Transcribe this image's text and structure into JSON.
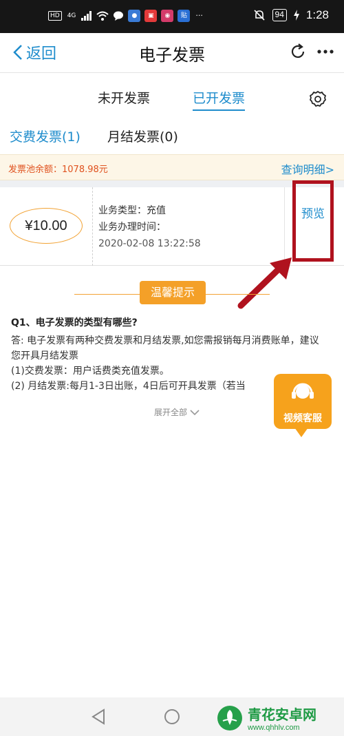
{
  "status_bar": {
    "signal_label": "HD",
    "network": "4G",
    "battery": "94",
    "time": "1:28",
    "icons": [
      "wifi-icon",
      "chat-icon",
      "app-icon",
      "notification-off-icon",
      "charging-icon"
    ]
  },
  "nav": {
    "back_label": "返回",
    "title": "电子发票"
  },
  "tabs": {
    "unissued": "未开发票",
    "issued": "已开发票"
  },
  "subtabs": {
    "payment": "交费发票(1)",
    "monthly": "月结发票(0)"
  },
  "pool": {
    "balance": "发票池余额：1078.98元",
    "link": "查询明细>"
  },
  "invoice": {
    "amount": "¥10.00",
    "type_line": "业务类型：充值",
    "time_label": "业务办理时间：",
    "time_value": "2020-02-08 13:22:58",
    "preview": "预览"
  },
  "tips": {
    "badge": "温馨提示",
    "question": "Q1、电子发票的类型有哪些?",
    "answer": "答: 电子发票有两种交费发票和月结发票,如您需报销每月消费账单，建议您开具月结发票",
    "item1": "(1)交费发票：用户话费类充值发票。",
    "item2": "(2) 月结发票:每月1-3日出账，4日后可开具发票（若当",
    "expand": "展开全部"
  },
  "video_service": {
    "label": "视频客服"
  },
  "watermark": {
    "title": "青花安卓网",
    "url": "www.qhhlv.com"
  },
  "colors": {
    "accent": "#1e8ccc",
    "orange": "#f4a028",
    "highlight": "#b0121e",
    "status_bar": "#161616"
  }
}
